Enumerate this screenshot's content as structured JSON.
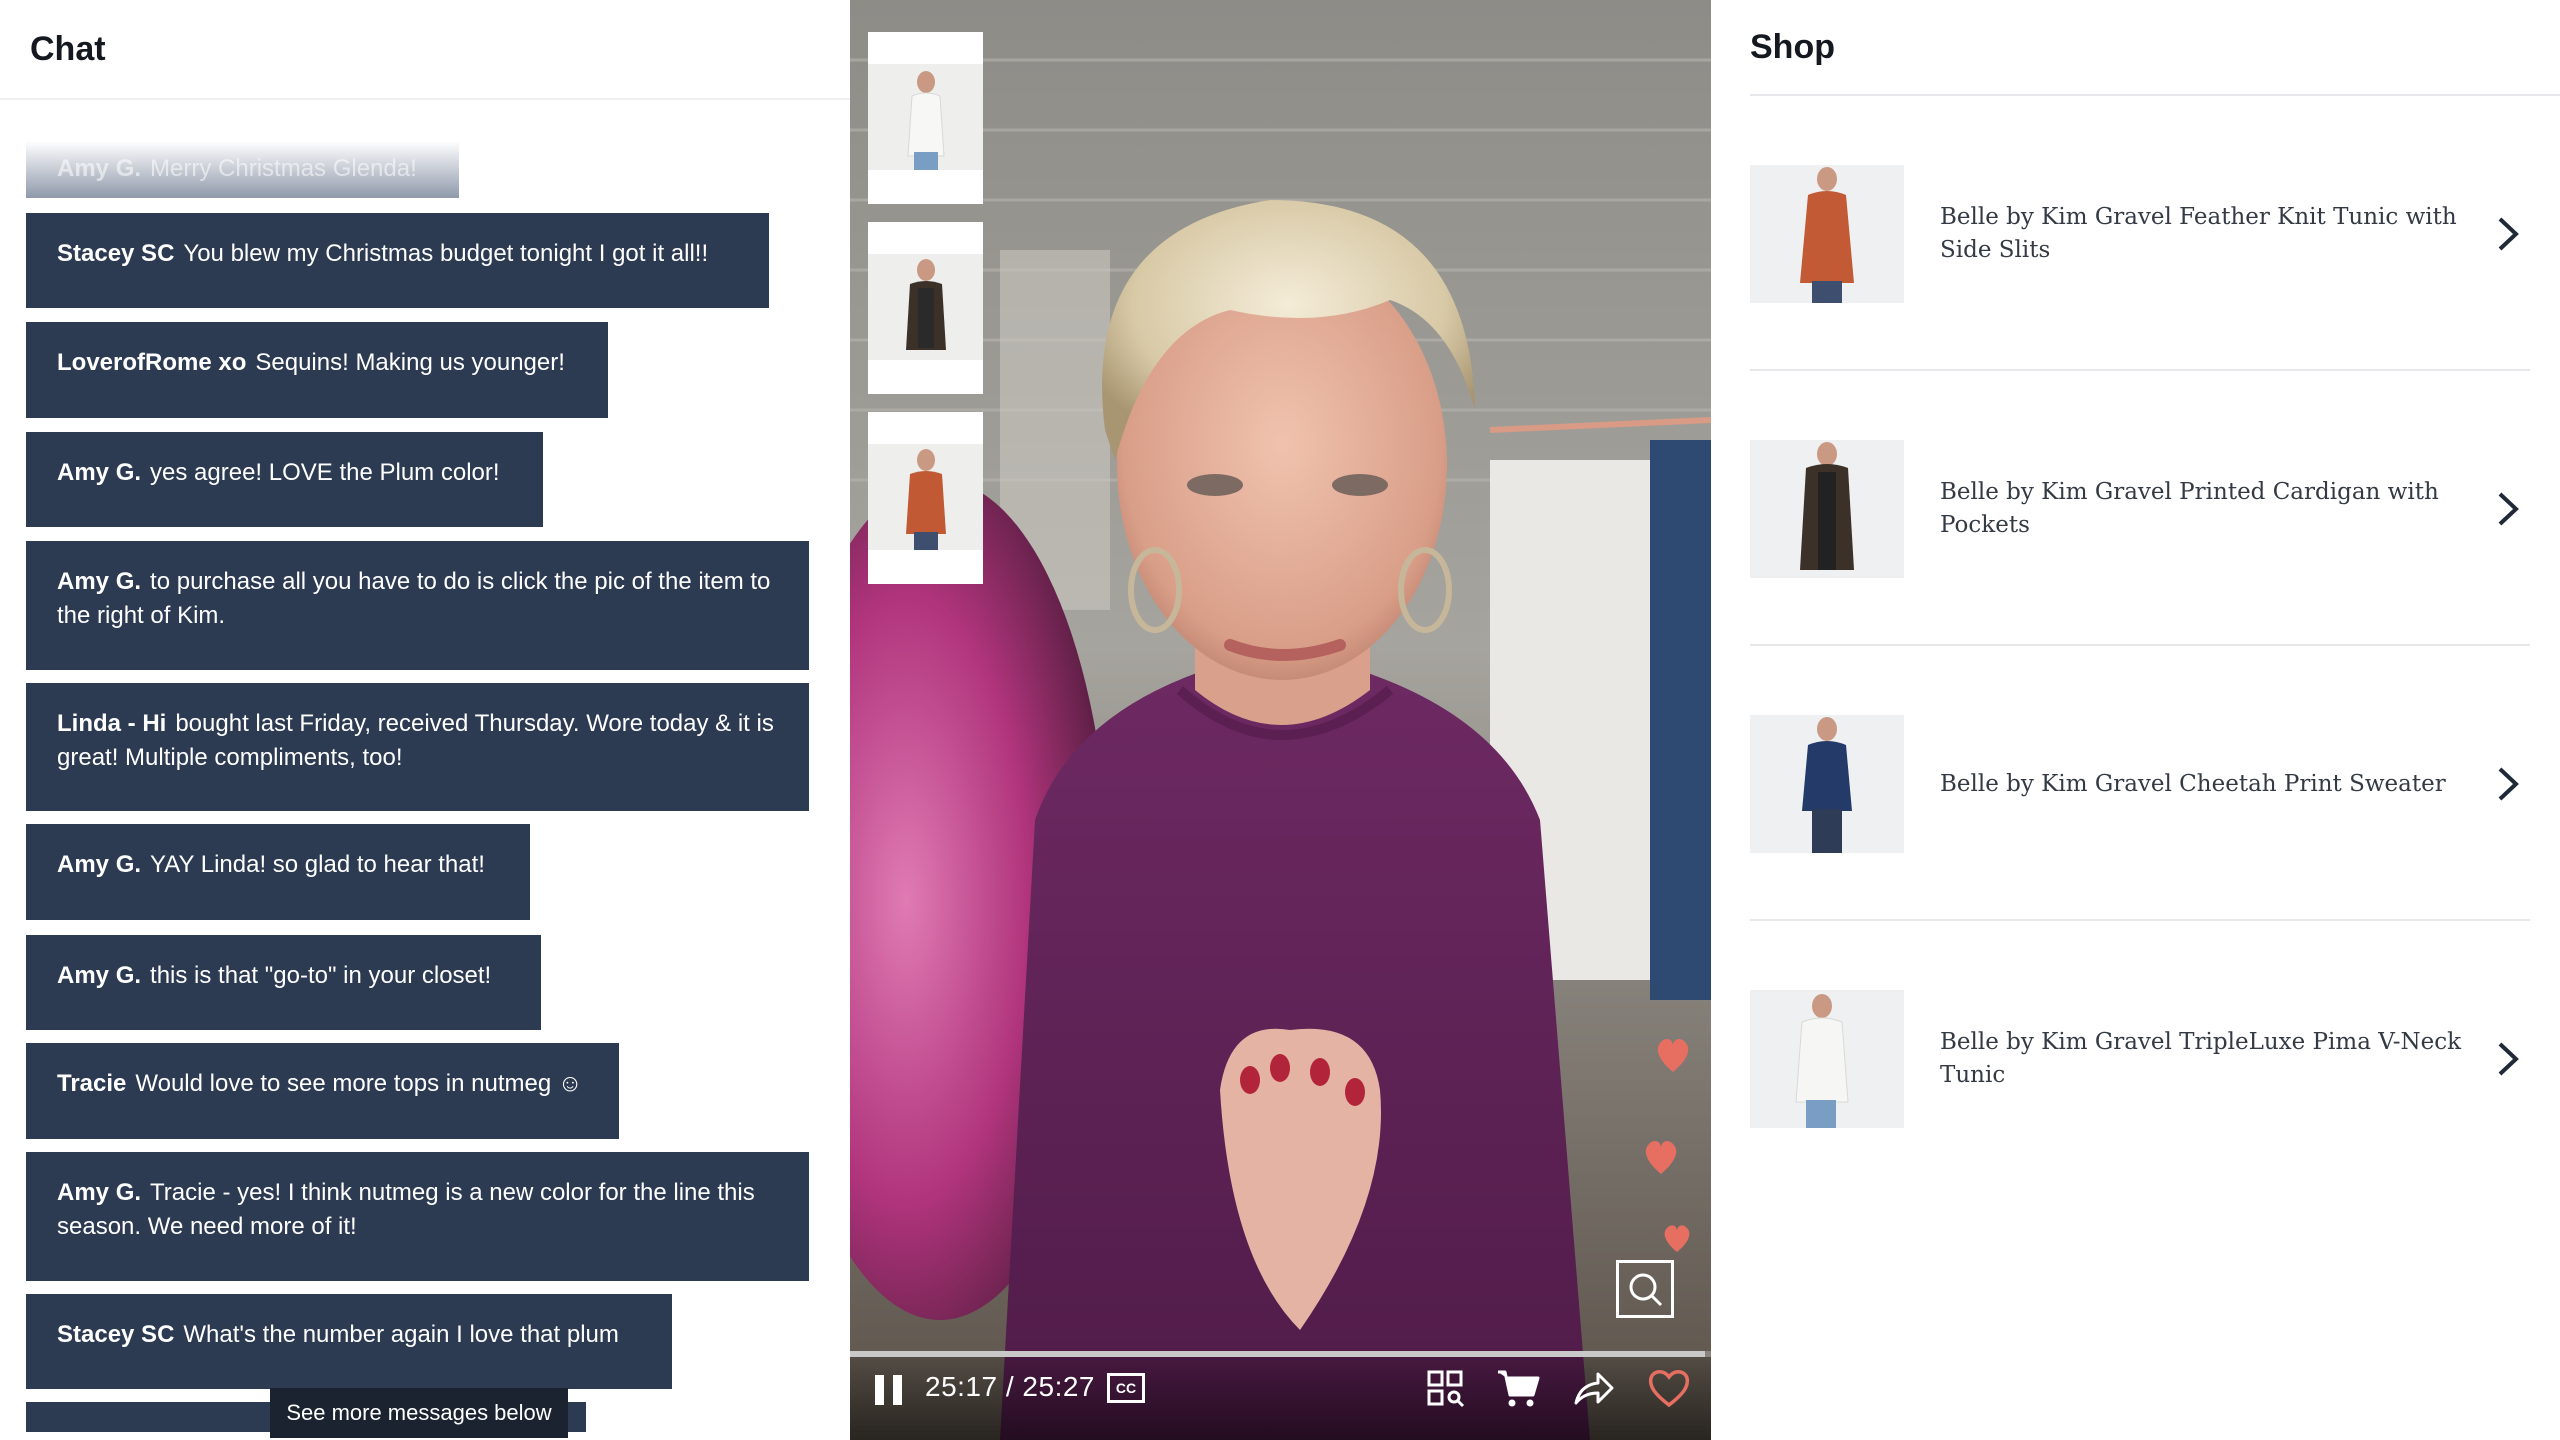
{
  "chat": {
    "title": "Chat",
    "messages": [
      {
        "user": "Amy G.",
        "text": "Merry Christmas Glenda!"
      },
      {
        "user": "Stacey SC",
        "text": "You blew my Christmas budget tonight I got it all!!"
      },
      {
        "user": "LoverofRome xo",
        "text": "Sequins! Making us younger!"
      },
      {
        "user": "Amy G.",
        "text": "yes agree! LOVE the Plum color!"
      },
      {
        "user": "Amy G.",
        "text": "to purchase all you have to do is click the pic of the item to the right of Kim."
      },
      {
        "user": "Linda - Hi",
        "text": "bought last Friday, received Thursday. Wore today & it is great! Multiple compliments, too!"
      },
      {
        "user": "Amy G.",
        "text": "YAY Linda! so glad to hear that!"
      },
      {
        "user": "Amy G.",
        "text": "this is that \"go-to\" in your closet!"
      },
      {
        "user": "Tracie",
        "text": "Would love to see more tops in nutmeg ☺"
      },
      {
        "user": "Amy G.",
        "text": "Tracie - yes! I think nutmeg is a new color for the line this season. We need more of it!"
      },
      {
        "user": "Stacey SC",
        "text": "What's the number again I love that plum"
      }
    ],
    "see_more_label": "See more messages below"
  },
  "video": {
    "current_time": "25:17",
    "duration": "25:27",
    "time_separator": " / ",
    "progress": 0.993,
    "cc_label": "CC",
    "icons": [
      "pause-icon",
      "closed-captions-icon",
      "grid-icon",
      "cart-icon",
      "share-icon",
      "heart-icon",
      "zoom-search-icon"
    ],
    "thumbnail_colors": [
      "#f2f2f0",
      "#3b3128",
      "#c15a34"
    ],
    "accent_heart": "#e76f61"
  },
  "shop": {
    "title": "Shop",
    "products": [
      {
        "name": "Belle by Kim Gravel Feather Knit Tunic with Side Slits",
        "color": "#c25a35"
      },
      {
        "name": "Belle by Kim Gravel Printed Cardigan with Pockets",
        "color": "#3b3128"
      },
      {
        "name": "Belle by Kim Gravel Cheetah Print Sweater",
        "color": "#243a68"
      },
      {
        "name": "Belle by Kim Gravel TripleLuxe Pima V-Neck Tunic",
        "color": "#f3f3f1"
      }
    ]
  }
}
